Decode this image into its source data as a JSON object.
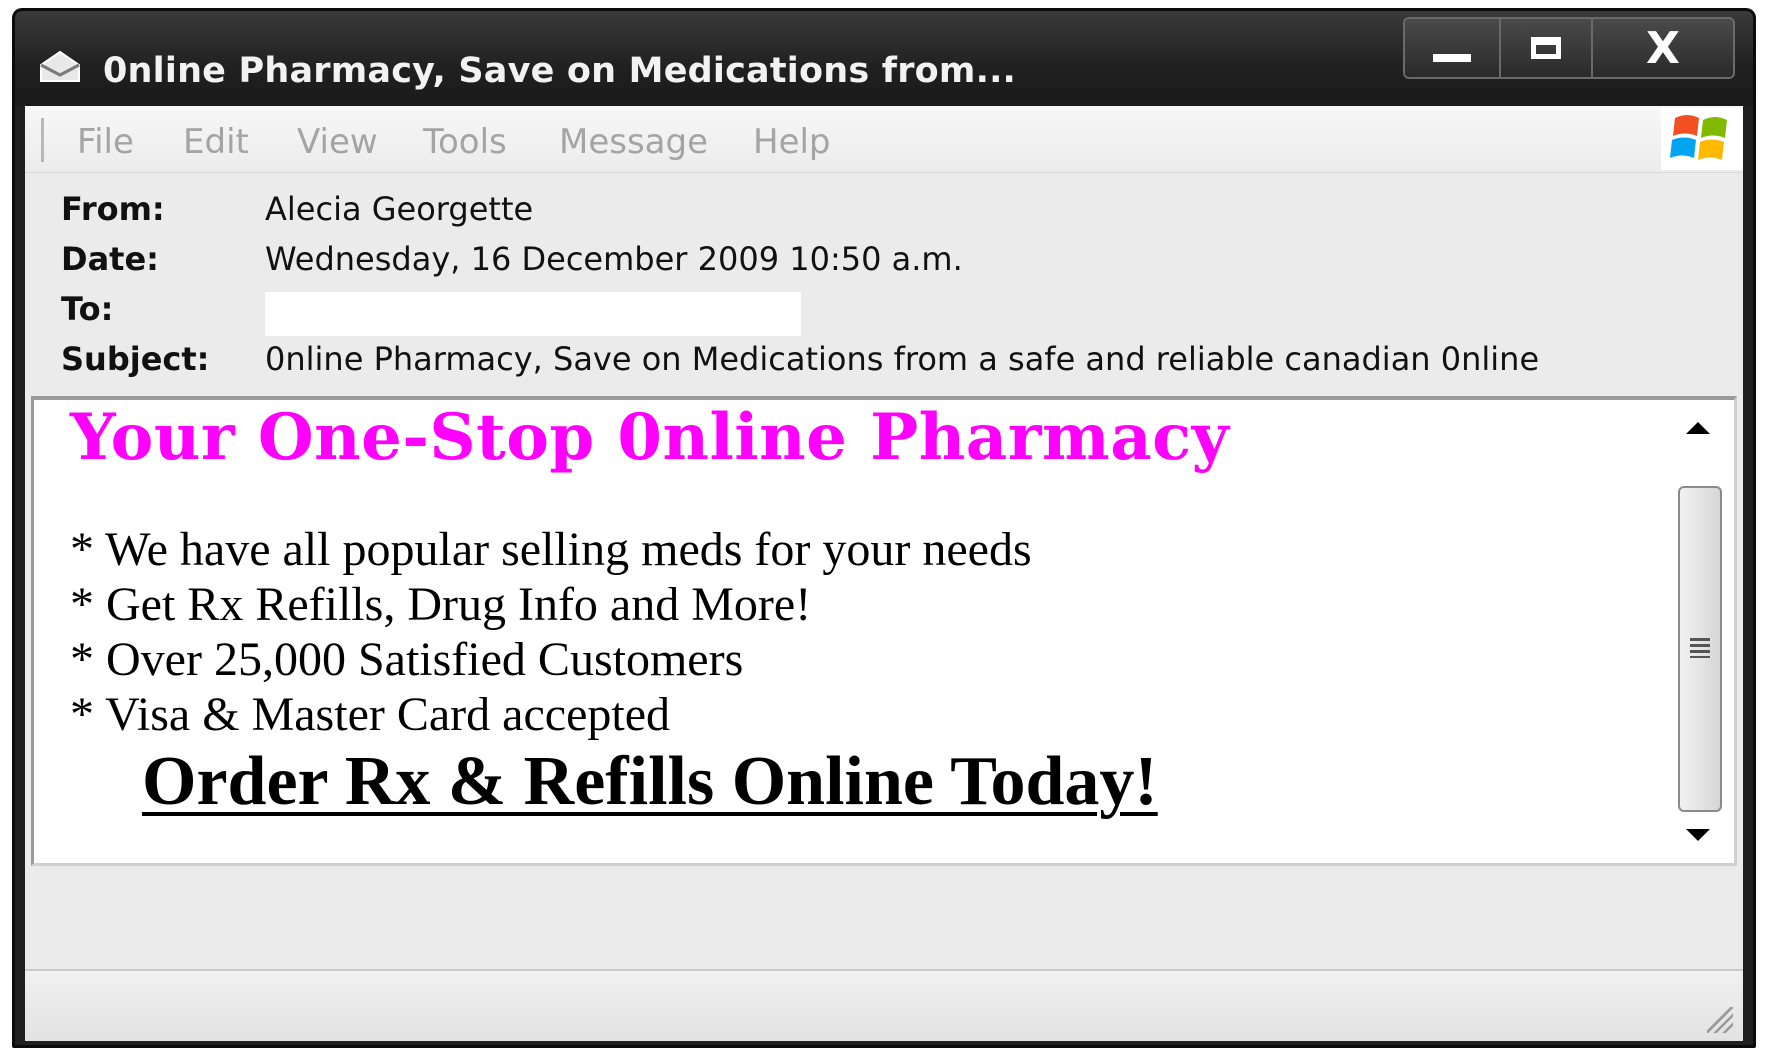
{
  "window": {
    "title": "0nline Pharmacy, Save on Medications from...",
    "title_icon": "envelope-icon",
    "buttons": {
      "minimize_icon": "minimize-icon",
      "maximize_icon": "maximize-icon",
      "close_label": "X"
    }
  },
  "menubar": {
    "items": [
      "File",
      "Edit",
      "View",
      "Tools",
      "Message",
      "Help"
    ],
    "logo_icon": "windows-logo-icon"
  },
  "header": {
    "from_label": "From:",
    "from_value": "Alecia Georgette",
    "date_label": "Date:",
    "date_value": "Wednesday, 16 December 2009 10:50 a.m.",
    "to_label": "To:",
    "to_value": "",
    "subject_label": "Subject:",
    "subject_value": "0nline Pharmacy, Save on Medications from a safe and reliable canadian 0nline"
  },
  "message": {
    "headline": "Your One-Stop 0nline Pharmacy",
    "headline_color": "#ff00ff",
    "bullets": [
      "* We have all popular selling meds for your needs",
      "* Get Rx Refills, Drug Info and More!",
      "* Over 25,000 Satisfied Customers",
      "* Visa & Master Card accepted"
    ],
    "cta": "Order Rx & Refills Online Today!"
  }
}
